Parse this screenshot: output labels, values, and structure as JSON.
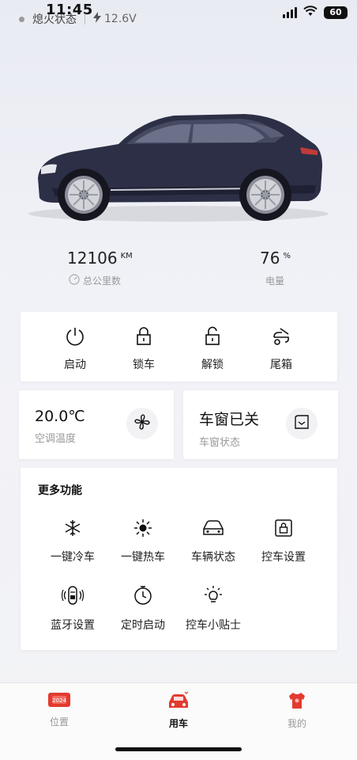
{
  "status_bar": {
    "time": "11:45",
    "battery": "60"
  },
  "vehicle": {
    "engine_state": "熄火状态",
    "voltage": "12.6V"
  },
  "stats": {
    "mileage": {
      "value": "12106",
      "unit": "KM",
      "label": "总公里数"
    },
    "battery": {
      "value": "76",
      "unit": "%",
      "label": "电量"
    }
  },
  "quick_actions": [
    {
      "label": "启动",
      "icon": "power-icon"
    },
    {
      "label": "锁车",
      "icon": "lock-icon"
    },
    {
      "label": "解锁",
      "icon": "unlock-icon"
    },
    {
      "label": "尾箱",
      "icon": "trunk-icon"
    }
  ],
  "climate": {
    "value": "20.0℃",
    "label": "空调温度",
    "icon": "fan-icon"
  },
  "window": {
    "value": "车窗已关",
    "label": "车窗状态",
    "icon": "window-icon"
  },
  "more": {
    "title": "更多功能",
    "items": [
      {
        "label": "一键冷车",
        "icon": "snowflake-icon"
      },
      {
        "label": "一键热车",
        "icon": "sun-icon"
      },
      {
        "label": "车辆状态",
        "icon": "car-status-icon"
      },
      {
        "label": "控车设置",
        "icon": "lock-settings-icon"
      },
      {
        "label": "蓝牙设置",
        "icon": "bluetooth-car-icon"
      },
      {
        "label": "定时启动",
        "icon": "timer-icon"
      },
      {
        "label": "控车小贴士",
        "icon": "bulb-icon"
      }
    ]
  },
  "nav": [
    {
      "label": "位置",
      "icon": "map-card-icon",
      "active": false
    },
    {
      "label": "用车",
      "icon": "car-nav-icon",
      "active": true
    },
    {
      "label": "我的",
      "icon": "shirt-icon",
      "active": false
    }
  ],
  "colors": {
    "accent": "#e23b2f",
    "background": "#f1f2f7",
    "card": "#ffffff"
  }
}
